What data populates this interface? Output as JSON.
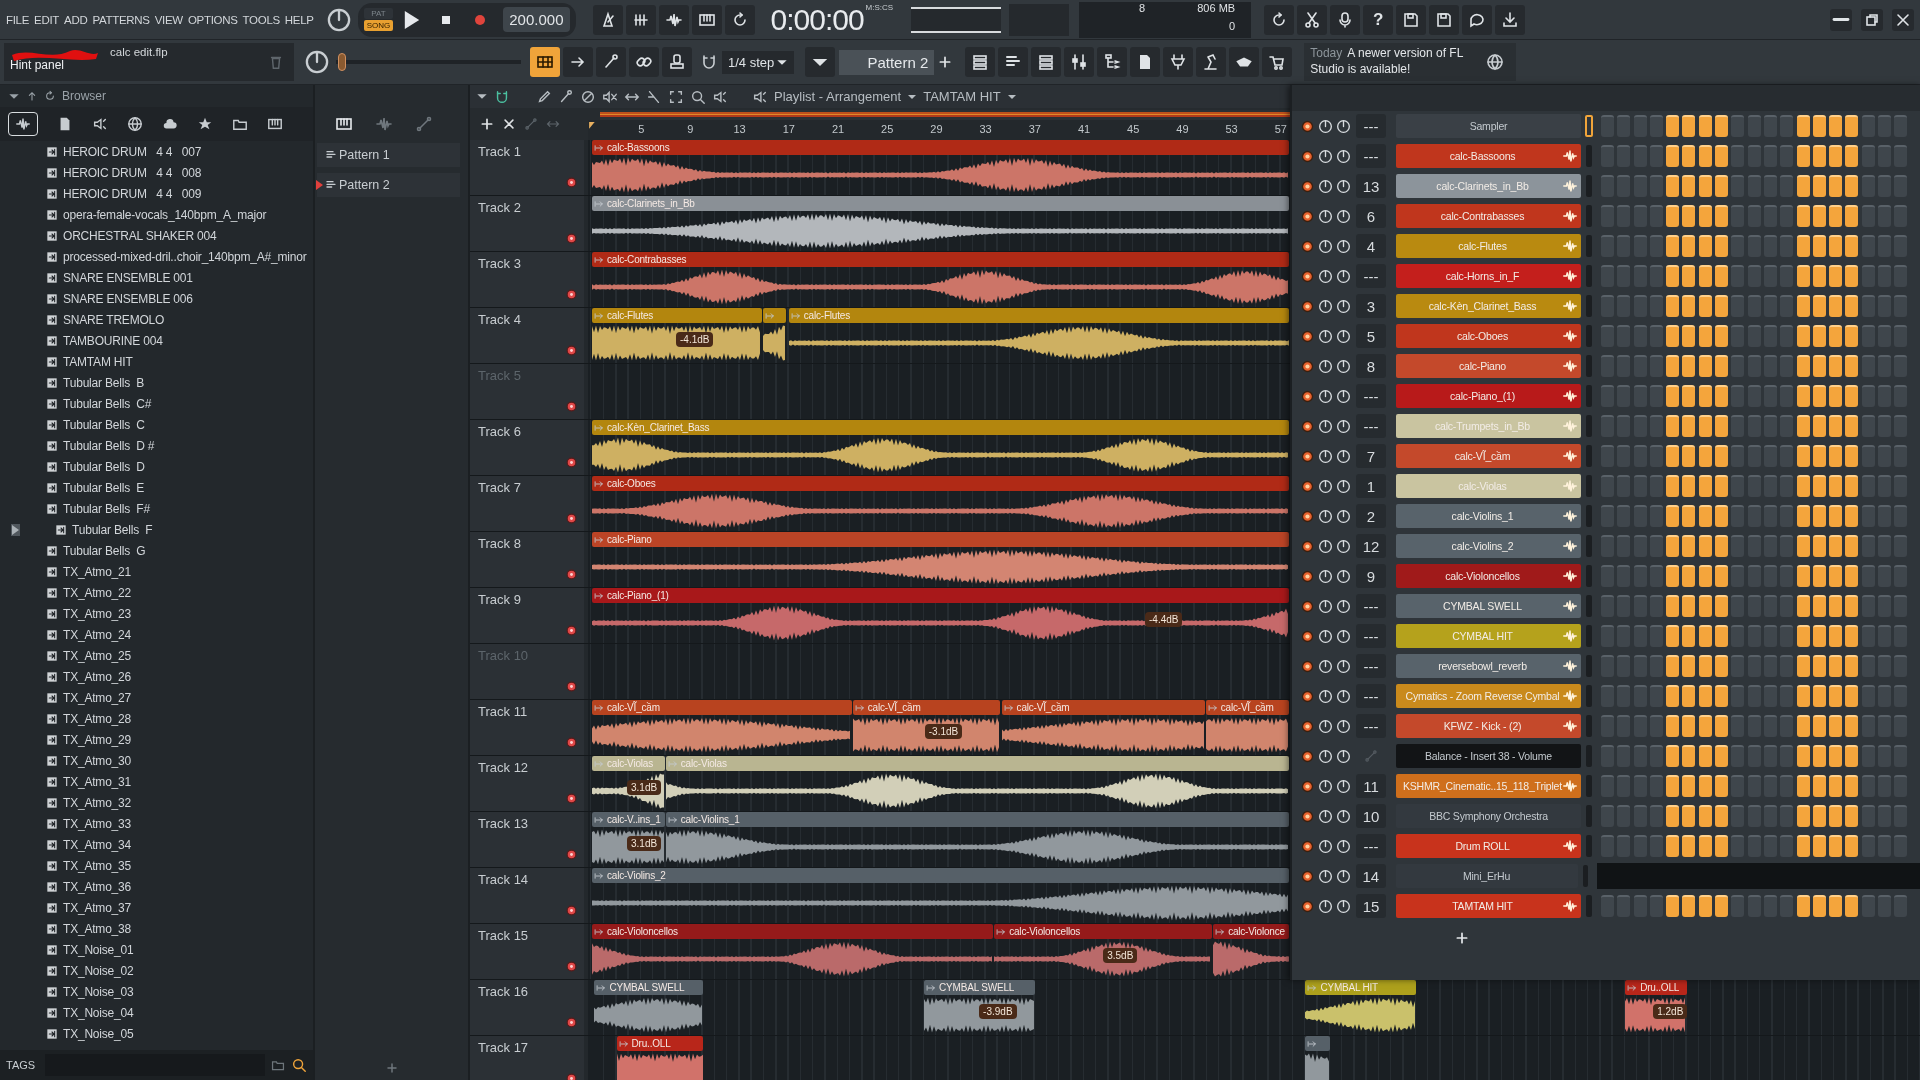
{
  "menu": [
    "FILE",
    "EDIT",
    "ADD",
    "PATTERNS",
    "VIEW",
    "OPTIONS",
    "TOOLS",
    "HELP"
  ],
  "transport": {
    "modes": [
      {
        "label": "PAT",
        "selected": false
      },
      {
        "label": "SONG",
        "selected": true
      }
    ],
    "tempo": "200.000",
    "time": "0:00:00",
    "time_format": "M:S:CS"
  },
  "monitor": {
    "cpu": "8",
    "memory": "806 MB",
    "polyphony": "0"
  },
  "project": {
    "file": "calc edit.flp",
    "hint": "Hint panel"
  },
  "pitch_slider": {
    "level": 0.03
  },
  "toolbar": {
    "help": "?",
    "snap": "1/4 step",
    "pattern": "Pattern 2"
  },
  "news": {
    "date": "Today",
    "message": "A newer version of FL Studio is available!"
  },
  "browser": {
    "title": "Browser",
    "tags_label": "TAGS",
    "items": [
      {
        "name": "HEROIC DRUM   4 4   007",
        "selected": false
      },
      {
        "name": "HEROIC DRUM   4 4   008",
        "selected": false
      },
      {
        "name": "HEROIC DRUM   4 4   009",
        "selected": false
      },
      {
        "name": "opera-female-vocals_140bpm_A_major",
        "selected": false
      },
      {
        "name": "ORCHESTRAL SHAKER 004",
        "selected": false
      },
      {
        "name": "processed-mixed-dril..choir_140bpm_A#_minor",
        "selected": false
      },
      {
        "name": "SNARE ENSEMBLE 001",
        "selected": false
      },
      {
        "name": "SNARE ENSEMBLE 006",
        "selected": false
      },
      {
        "name": "SNARE TREMOLO",
        "selected": false
      },
      {
        "name": "TAMBOURINE 004",
        "selected": false
      },
      {
        "name": "TAMTAM HIT",
        "selected": false
      },
      {
        "name": "Tubular Bells  B",
        "selected": false
      },
      {
        "name": "Tubular Bells  C#",
        "selected": false
      },
      {
        "name": "Tubular Bells  C",
        "selected": false
      },
      {
        "name": "Tubular Bells  D #",
        "selected": false
      },
      {
        "name": "Tubular Bells  D",
        "selected": false
      },
      {
        "name": "Tubular Bells  E",
        "selected": false
      },
      {
        "name": "Tubular Bells  F#",
        "selected": false
      },
      {
        "name": "Tubular Bells  F",
        "selected": true
      },
      {
        "name": "Tubular Bells  G",
        "selected": false
      },
      {
        "name": "TX_Atmo_21",
        "selected": false
      },
      {
        "name": "TX_Atmo_22",
        "selected": false
      },
      {
        "name": "TX_Atmo_23",
        "selected": false
      },
      {
        "name": "TX_Atmo_24",
        "selected": false
      },
      {
        "name": "TX_Atmo_25",
        "selected": false
      },
      {
        "name": "TX_Atmo_26",
        "selected": false
      },
      {
        "name": "TX_Atmo_27",
        "selected": false
      },
      {
        "name": "TX_Atmo_28",
        "selected": false
      },
      {
        "name": "TX_Atmo_29",
        "selected": false
      },
      {
        "name": "TX_Atmo_30",
        "selected": false
      },
      {
        "name": "TX_Atmo_31",
        "selected": false
      },
      {
        "name": "TX_Atmo_32",
        "selected": false
      },
      {
        "name": "TX_Atmo_33",
        "selected": false
      },
      {
        "name": "TX_Atmo_34",
        "selected": false
      },
      {
        "name": "TX_Atmo_35",
        "selected": false
      },
      {
        "name": "TX_Atmo_36",
        "selected": false
      },
      {
        "name": "TX_Atmo_37",
        "selected": false
      },
      {
        "name": "TX_Atmo_38",
        "selected": false
      },
      {
        "name": "TX_Noise_01",
        "selected": false
      },
      {
        "name": "TX_Noise_02",
        "selected": false
      },
      {
        "name": "TX_Noise_03",
        "selected": false
      },
      {
        "name": "TX_Noise_04",
        "selected": false
      },
      {
        "name": "TX_Noise_05",
        "selected": false
      }
    ]
  },
  "patterns": [
    {
      "name": "Pattern 1",
      "selected": false
    },
    {
      "name": "Pattern 2",
      "selected": true
    }
  ],
  "playlist": {
    "title": "Playlist - Arrangement",
    "pattern": "TAMTAM HIT",
    "ruler": [
      "5",
      "9",
      "13",
      "17",
      "21",
      "25",
      "29",
      "33",
      "37",
      "41",
      "45",
      "49",
      "53",
      "57"
    ],
    "tracks": [
      {
        "name": "Track 1",
        "clips": [
          {
            "label": "calc-Bassoons",
            "color": "#b02a16"
          }
        ]
      },
      {
        "name": "Track 2",
        "clips": [
          {
            "label": "calc-Clarinets_in_Bb",
            "color": "#8a9096"
          }
        ]
      },
      {
        "name": "Track 3",
        "clips": [
          {
            "label": "calc-Contrabasses",
            "color": "#b02a16"
          }
        ]
      },
      {
        "name": "Track 4",
        "clips": [
          {
            "label": "calc-Flutes",
            "color": "#b3860e",
            "gain": "-4.1dB"
          },
          {
            "color": "#b3860e"
          },
          {
            "label": "calc-Flutes",
            "color": "#b3860e"
          }
        ]
      },
      {
        "name": "Track 5"
      },
      {
        "name": "Track 6",
        "clips": [
          {
            "label": "calc-Kèn_Clarinet_Bass",
            "color": "#b3860e"
          }
        ]
      },
      {
        "name": "Track 7",
        "clips": [
          {
            "label": "calc-Oboes",
            "color": "#b02a16"
          }
        ]
      },
      {
        "name": "Track 8",
        "clips": [
          {
            "label": "calc-Piano",
            "color": "#bb4426"
          }
        ]
      },
      {
        "name": "Track 9",
        "clips": [
          {
            "label": "calc-Piano_(1)",
            "color": "#a8181a",
            "gain": "-4.4dB"
          }
        ]
      },
      {
        "name": "Track 10"
      },
      {
        "name": "Track 11",
        "clips": [
          {
            "label": "calc-VĨ_cầm",
            "color": "#b8431f"
          },
          {
            "label": "calc-VĨ_cầm",
            "color": "#b8431f",
            "gain": "-3.1dB"
          },
          {
            "label": "calc-VĨ_cầm",
            "color": "#b8431f"
          },
          {
            "label": "calc-VĨ_cầm",
            "color": "#b8431f"
          }
        ]
      },
      {
        "name": "Track 12",
        "clips": [
          {
            "label": "calc-Violas",
            "color": "#b9b591",
            "gain": "3.1dB"
          },
          {
            "label": "calc-Violas",
            "color": "#b9b591"
          }
        ]
      },
      {
        "name": "Track 13",
        "clips": [
          {
            "label": "calc-V..ins_1",
            "color": "#566068",
            "gain": "3.1dB"
          },
          {
            "label": "calc-Violins_1",
            "color": "#566068"
          }
        ]
      },
      {
        "name": "Track 14",
        "clips": [
          {
            "label": "calc-Violins_2",
            "color": "#566068"
          }
        ]
      },
      {
        "name": "Track 15",
        "clips": [
          {
            "label": "calc-Violoncellos",
            "color": "#951a1a"
          },
          {
            "label": "calc-Violoncellos",
            "color": "#951a1a",
            "gain": "3.5dB"
          },
          {
            "label": "calc-Violonce",
            "color": "#951a1a"
          }
        ]
      },
      {
        "name": "Track 16",
        "clips": [
          {
            "label": "CYMBAL SWELL",
            "color": "#566068"
          },
          {
            "label": "CYMBAL SWELL",
            "color": "#566068",
            "gain": "-3.9dB"
          },
          {
            "label": "CYMBAL HIT",
            "color": "#ada01c"
          },
          {
            "label": "Dru..OLL",
            "color": "#b8261a",
            "gain": "1.2dB"
          }
        ]
      },
      {
        "name": "Track 17",
        "clips": [
          {
            "label": "Dru..OLL",
            "color": "#b8261a"
          },
          {
            "color": "#566068"
          }
        ]
      }
    ]
  },
  "channel_rack": {
    "channels": [
      {
        "number": "---",
        "name": "Sampler",
        "kind": "plugin",
        "color": "#3a4046",
        "selected": true,
        "steps": [
          false,
          false,
          false,
          false,
          true,
          true,
          true,
          true,
          false,
          false,
          false,
          false,
          true,
          true,
          true,
          true,
          false,
          false,
          false
        ]
      },
      {
        "number": "---",
        "name": "calc-Bassoons",
        "kind": "audio",
        "color": "#c0361d",
        "selected": false,
        "steps": [
          false,
          false,
          false,
          false,
          true,
          true,
          true,
          true,
          false,
          false,
          false,
          false,
          true,
          true,
          true,
          true,
          false,
          false,
          false
        ]
      },
      {
        "number": "13",
        "name": "calc-Clarinets_in_Bb",
        "kind": "audio",
        "color": "#8c949b",
        "selected": false,
        "steps": [
          false,
          false,
          false,
          false,
          true,
          true,
          true,
          true,
          false,
          false,
          false,
          false,
          true,
          true,
          true,
          true,
          false,
          false,
          false
        ]
      },
      {
        "number": "6",
        "name": "calc-Contrabasses",
        "kind": "audio",
        "color": "#c0361d",
        "selected": false,
        "steps": [
          false,
          false,
          false,
          false,
          true,
          true,
          true,
          true,
          false,
          false,
          false,
          false,
          true,
          true,
          true,
          true,
          false,
          false,
          false
        ]
      },
      {
        "number": "4",
        "name": "calc-Flutes",
        "kind": "audio",
        "color": "#b98a10",
        "selected": false,
        "steps": [
          false,
          false,
          false,
          false,
          true,
          true,
          true,
          true,
          false,
          false,
          false,
          false,
          true,
          true,
          true,
          true,
          false,
          false,
          false
        ]
      },
      {
        "number": "---",
        "name": "calc-Horns_in_F",
        "kind": "audio",
        "color": "#c41f1c",
        "selected": false,
        "steps": [
          false,
          false,
          false,
          false,
          true,
          true,
          true,
          true,
          false,
          false,
          false,
          false,
          true,
          true,
          true,
          true,
          false,
          false,
          false
        ]
      },
      {
        "number": "3",
        "name": "calc-Kèn_Clarinet_Bass",
        "kind": "audio",
        "color": "#b98a10",
        "selected": false,
        "steps": [
          false,
          false,
          false,
          false,
          true,
          true,
          true,
          true,
          false,
          false,
          false,
          false,
          true,
          true,
          true,
          true,
          false,
          false,
          false
        ]
      },
      {
        "number": "5",
        "name": "calc-Oboes",
        "kind": "audio",
        "color": "#c0361d",
        "selected": false,
        "steps": [
          false,
          false,
          false,
          false,
          true,
          true,
          true,
          true,
          false,
          false,
          false,
          false,
          true,
          true,
          true,
          true,
          false,
          false,
          false
        ]
      },
      {
        "number": "8",
        "name": "calc-Piano",
        "kind": "audio",
        "color": "#c4492b",
        "selected": false,
        "steps": [
          false,
          false,
          false,
          false,
          true,
          true,
          true,
          true,
          false,
          false,
          false,
          false,
          true,
          true,
          true,
          true,
          false,
          false,
          false
        ]
      },
      {
        "number": "---",
        "name": "calc-Piano_(1)",
        "kind": "audio",
        "color": "#b81a1a",
        "selected": false,
        "steps": [
          false,
          false,
          false,
          false,
          true,
          true,
          true,
          true,
          false,
          false,
          false,
          false,
          true,
          true,
          true,
          true,
          false,
          false,
          false
        ]
      },
      {
        "number": "---",
        "name": "calc-Trumpets_in_Bb",
        "kind": "audio",
        "color": "#c9c4a0",
        "selected": false,
        "steps": [
          false,
          false,
          false,
          false,
          true,
          true,
          true,
          true,
          false,
          false,
          false,
          false,
          true,
          true,
          true,
          true,
          false,
          false,
          false
        ]
      },
      {
        "number": "7",
        "name": "calc-VĨ_cầm",
        "kind": "audio",
        "color": "#c4492b",
        "selected": false,
        "steps": [
          false,
          false,
          false,
          false,
          true,
          true,
          true,
          true,
          false,
          false,
          false,
          false,
          true,
          true,
          true,
          true,
          false,
          false,
          false
        ]
      },
      {
        "number": "1",
        "name": "calc-Violas",
        "kind": "audio",
        "color": "#c9c4a0",
        "selected": false,
        "steps": [
          false,
          false,
          false,
          false,
          true,
          true,
          true,
          true,
          false,
          false,
          false,
          false,
          true,
          true,
          true,
          true,
          false,
          false,
          false
        ]
      },
      {
        "number": "2",
        "name": "calc-Violins_1",
        "kind": "audio",
        "color": "#58636b",
        "selected": false,
        "steps": [
          false,
          false,
          false,
          false,
          true,
          true,
          true,
          true,
          false,
          false,
          false,
          false,
          true,
          true,
          true,
          true,
          false,
          false,
          false
        ]
      },
      {
        "number": "12",
        "name": "calc-Violins_2",
        "kind": "audio",
        "color": "#58636b",
        "selected": false,
        "steps": [
          false,
          false,
          false,
          false,
          true,
          true,
          true,
          true,
          false,
          false,
          false,
          false,
          true,
          true,
          true,
          true,
          false,
          false,
          false
        ]
      },
      {
        "number": "9",
        "name": "calc-Violoncellos",
        "kind": "audio",
        "color": "#a01a1a",
        "selected": false,
        "steps": [
          false,
          false,
          false,
          false,
          true,
          true,
          true,
          true,
          false,
          false,
          false,
          false,
          true,
          true,
          true,
          true,
          false,
          false,
          false
        ]
      },
      {
        "number": "---",
        "name": "CYMBAL SWELL",
        "kind": "audio",
        "color": "#58636b",
        "selected": false,
        "steps": [
          false,
          false,
          false,
          false,
          true,
          true,
          true,
          true,
          false,
          false,
          false,
          false,
          true,
          true,
          true,
          true,
          false,
          false,
          false
        ]
      },
      {
        "number": "---",
        "name": "CYMBAL HIT",
        "kind": "audio",
        "color": "#b5a21c",
        "selected": false,
        "steps": [
          false,
          false,
          false,
          false,
          true,
          true,
          true,
          true,
          false,
          false,
          false,
          false,
          true,
          true,
          true,
          true,
          false,
          false,
          false
        ]
      },
      {
        "number": "---",
        "name": "reversebowl_reverb",
        "kind": "audio",
        "color": "#58636b",
        "selected": false,
        "steps": [
          false,
          false,
          false,
          false,
          true,
          true,
          true,
          true,
          false,
          false,
          false,
          false,
          true,
          true,
          true,
          true,
          false,
          false,
          false
        ]
      },
      {
        "number": "---",
        "name": "Cymatics - Zoom Reverse Cymbal",
        "kind": "audio",
        "color": "#c98a1c",
        "selected": false,
        "steps": [
          false,
          false,
          false,
          false,
          true,
          true,
          true,
          true,
          false,
          false,
          false,
          false,
          true,
          true,
          true,
          true,
          false,
          false,
          false
        ]
      },
      {
        "number": "---",
        "name": "KFWZ - Kick - (2)",
        "kind": "audio",
        "color": "#c4492b",
        "selected": false,
        "steps": [
          false,
          false,
          false,
          false,
          true,
          true,
          true,
          true,
          false,
          false,
          false,
          false,
          true,
          true,
          true,
          true,
          false,
          false,
          false
        ]
      },
      {
        "name": "Balance - Insert 38 - Volume",
        "kind": "automation",
        "color": "#121416",
        "selected": false,
        "steps": [
          false,
          false,
          false,
          false,
          true,
          true,
          true,
          true,
          false,
          false,
          false,
          false,
          true,
          true,
          true,
          true,
          false,
          false,
          false
        ]
      },
      {
        "number": "11",
        "name": "KSHMR_Cinematic..15_118_Triplet",
        "kind": "audio",
        "color": "#cf6f1c",
        "selected": false,
        "steps": [
          false,
          false,
          false,
          false,
          true,
          true,
          true,
          true,
          false,
          false,
          false,
          false,
          true,
          true,
          true,
          true,
          false,
          false,
          false
        ]
      },
      {
        "number": "10",
        "name": "BBC Symphony Orchestra",
        "kind": "plugin",
        "color": "#33393f",
        "selected": false,
        "steps": [
          false,
          false,
          false,
          false,
          true,
          true,
          true,
          true,
          false,
          false,
          false,
          false,
          true,
          true,
          true,
          true,
          false,
          false,
          false
        ]
      },
      {
        "number": "---",
        "name": "Drum ROLL",
        "kind": "audio",
        "color": "#c8331c",
        "selected": false,
        "steps": [
          false,
          false,
          false,
          false,
          true,
          true,
          true,
          true,
          false,
          false,
          false,
          false,
          true,
          true,
          true,
          true,
          false,
          false,
          false
        ]
      },
      {
        "number": "14",
        "name": "Mini_ErHu",
        "kind": "plugin",
        "color": "#33393f",
        "selected": false
      },
      {
        "number": "15",
        "name": "TAMTAM HIT",
        "kind": "audio",
        "color": "#c8331c",
        "selected": false,
        "steps": [
          false,
          false,
          false,
          false,
          true,
          true,
          true,
          true,
          false,
          false,
          false,
          false,
          true,
          true,
          true,
          true,
          false,
          false,
          false
        ]
      }
    ]
  }
}
